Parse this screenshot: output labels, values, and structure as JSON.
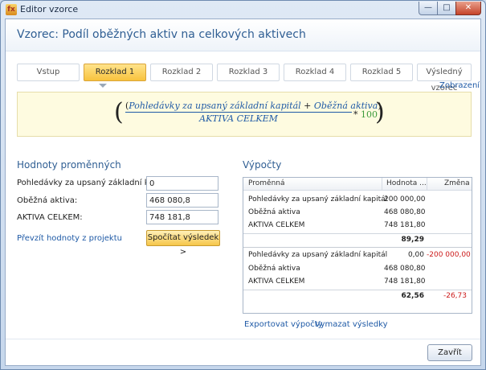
{
  "window": {
    "title": "Editor vzorce",
    "min_glyph": "—",
    "max_glyph": "□",
    "close_glyph": "✕",
    "icon_glyph": "fx"
  },
  "header": {
    "title": "Vzorec: Podíl oběžných aktiv na celkových aktivech"
  },
  "steps": [
    {
      "label": "Vstup",
      "active": false
    },
    {
      "label": "Rozklad 1",
      "active": true
    },
    {
      "label": "Rozklad 2",
      "active": false
    },
    {
      "label": "Rozklad 3",
      "active": false
    },
    {
      "label": "Rozklad 4",
      "active": false
    },
    {
      "label": "Rozklad 5",
      "active": false
    },
    {
      "label": "Výsledný vzorec",
      "active": false
    }
  ],
  "display_link": "Zobrazení",
  "formula": {
    "open_paren": "(",
    "close_paren": ")",
    "lparen_inner": "(",
    "term1": "Pohledávky za upsaný základní kapitál",
    "plus": "+",
    "term2": "Oběžná aktiva",
    "rparen_inner": ")",
    "denominator": "AKTIVA CELKEM",
    "times": "*",
    "multiplier": "100"
  },
  "variables": {
    "title": "Hodnoty proměnných",
    "items": [
      {
        "label": "Pohledávky za upsaný základní kapitál:",
        "value": "0"
      },
      {
        "label": "Oběžná aktiva:",
        "value": "468 080,8"
      },
      {
        "label": "AKTIVA CELKEM:",
        "value": "748 181,8"
      }
    ],
    "transfer_link": "Převzít hodnoty z projektu",
    "compute_button": "Spočítat výsledek >"
  },
  "calculations": {
    "title": "Výpočty",
    "columns": {
      "name": "Proměnná",
      "value": "Hodnota ...",
      "change": "Změna"
    },
    "groups": [
      {
        "rows": [
          {
            "name": "Pohledávky za upsaný základní kapitál",
            "value": "200 000,00",
            "change": ""
          },
          {
            "name": "Oběžná aktiva",
            "value": "468 080,80",
            "change": ""
          },
          {
            "name": "AKTIVA CELKEM",
            "value": "748 181,80",
            "change": ""
          }
        ],
        "total": {
          "value": "89,29",
          "change": ""
        }
      },
      {
        "rows": [
          {
            "name": "Pohledávky za upsaný základní kapitál",
            "value": "0,00",
            "change": "-200 000,00"
          },
          {
            "name": "Oběžná aktiva",
            "value": "468 080,80",
            "change": ""
          },
          {
            "name": "AKTIVA CELKEM",
            "value": "748 181,80",
            "change": ""
          }
        ],
        "total": {
          "value": "62,56",
          "change": "-26,73"
        }
      }
    ],
    "export_link": "Exportovat výpočty",
    "clear_link": "Vymazat výsledky"
  },
  "footer": {
    "close_button": "Zavřít"
  },
  "colors": {
    "accent": "#2f5e93",
    "link": "#1f5aa6",
    "negative": "#cc1a1a",
    "formula_bg": "#fefbe0",
    "active_step": "#f8c33d"
  }
}
